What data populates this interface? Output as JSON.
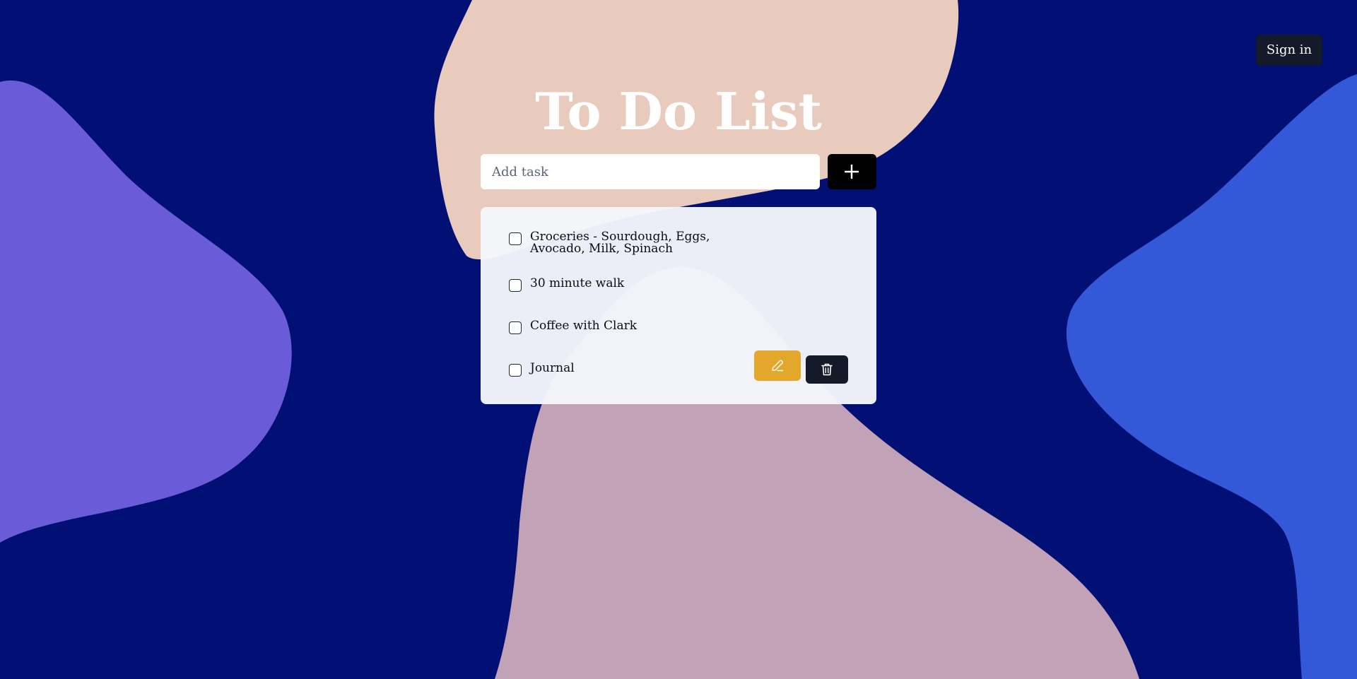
{
  "header": {
    "signin_label": "Sign in"
  },
  "main": {
    "title": "To Do List",
    "add_input": {
      "placeholder": "Add task",
      "value": ""
    },
    "add_button_icon": "plus-icon"
  },
  "tasks": [
    {
      "label": "Groceries - Sourdough, Eggs, Avocado, Milk, Spinach",
      "checked": false
    },
    {
      "label": "30 minute walk",
      "checked": false
    },
    {
      "label": "Coffee with Clark",
      "checked": false
    },
    {
      "label": "Journal",
      "checked": false
    }
  ],
  "task_actions": {
    "edit_icon": "pencil-icon",
    "delete_icon": "trash-icon"
  },
  "colors": {
    "background": "#020f75",
    "blob_left": "#6a5cd8",
    "blob_right": "#3459d8",
    "blob_top": "#e8cbbc",
    "blob_bottom": "#c2a2b7",
    "edit_button": "#e3a82b",
    "dark_button": "#151a2b",
    "add_button": "#000000",
    "card": "#f4f6fb"
  }
}
